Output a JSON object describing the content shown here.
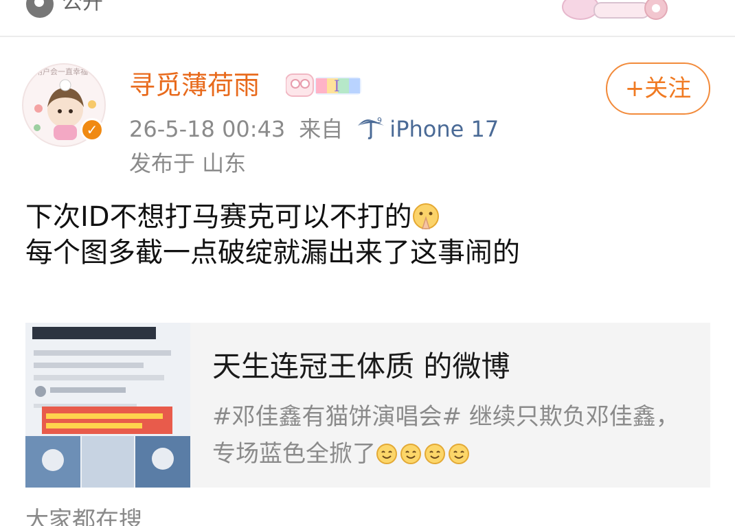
{
  "top_bar": {
    "visibility_label": "公开"
  },
  "post": {
    "username": "寻觅薄荷雨",
    "avatar_caption": "该用户会一直幸福",
    "follow_label": "+关注",
    "timestamp": "26-5-18 00:43",
    "source_prefix": "来自",
    "device": "iPhone 17",
    "location": "发布于 山东",
    "text_lines": [
      "下次ID不想打马赛克可以不打的",
      "每个图多截一点破绽就漏出来了这事闹的"
    ]
  },
  "quoted_card": {
    "title": "天生连冠王体质 的微博",
    "description": "#邓佳鑫有猫饼演唱会# 继续只欺负邓佳鑫，专场蓝色全掀了"
  },
  "section_label": "大家都在搜",
  "icons": [
    "globe-icon",
    "verified-badge-icon",
    "umbrella-icon",
    "pray-emoji-icon",
    "smile-emoji-icon"
  ],
  "colors": {
    "username": "#e86a1c",
    "follow": "#f07a22",
    "device": "#4a6a96",
    "meta": "#8a8a8a",
    "card_bg": "#f4f4f4"
  }
}
